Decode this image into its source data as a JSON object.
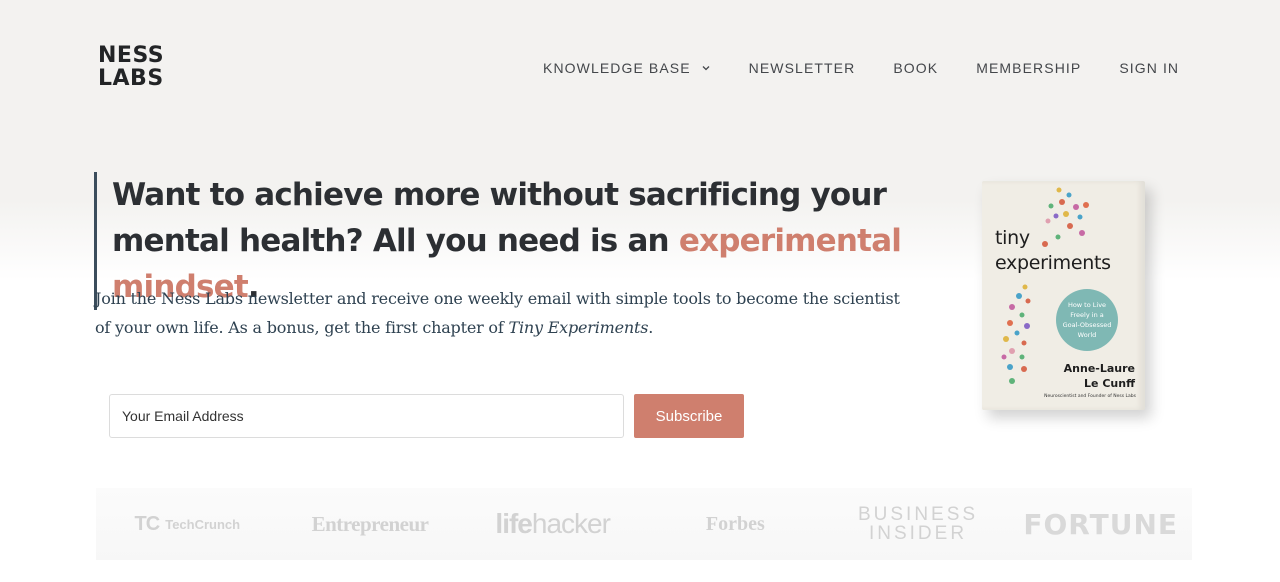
{
  "logo": {
    "line1": "NESS",
    "line2": "LABS"
  },
  "nav": {
    "items": [
      {
        "label": "KNOWLEDGE BASE",
        "has_dropdown": true
      },
      {
        "label": "NEWSLETTER"
      },
      {
        "label": "BOOK"
      },
      {
        "label": "MEMBERSHIP"
      },
      {
        "label": "SIGN IN"
      }
    ]
  },
  "hero": {
    "headline_bold": "Want to achieve more without sacrificing your mental health?",
    "headline_regular": " All you need is an ",
    "headline_accent": "experimental mindset",
    "headline_end": ".",
    "sub_before": "Join the Ness Labs newsletter and receive one weekly email with simple tools to become the scientist of your own life. As a bonus, get the first chapter of ",
    "sub_italic": "Tiny Experiments",
    "sub_after": "."
  },
  "form": {
    "email_placeholder": "Your Email Address",
    "subscribe_label": "Subscribe"
  },
  "book": {
    "title_line1": "tiny",
    "title_line2": "experiments",
    "circle_text": "How to Live Freely in a Goal-Obsessed World",
    "author_line1": "Anne-Laure",
    "author_line2": "Le Cunff",
    "tagline": "Neuroscientist and Founder of Ness Labs"
  },
  "press": {
    "techcrunch": "TechCrunch",
    "techcrunch_mark": "TC",
    "entrepreneur": "Entrepreneur",
    "lifehacker_a": "life",
    "lifehacker_b": "hacker",
    "forbes": "Forbes",
    "business_insider_1": "BUSINESS",
    "business_insider_2": "INSIDER",
    "fortune": "FORTUNE"
  },
  "colors": {
    "accent": "#cf7f6e",
    "hero_bg": "#f3f2f0",
    "text_dark": "#2c2f33",
    "book_circle": "#7fb8b4"
  }
}
